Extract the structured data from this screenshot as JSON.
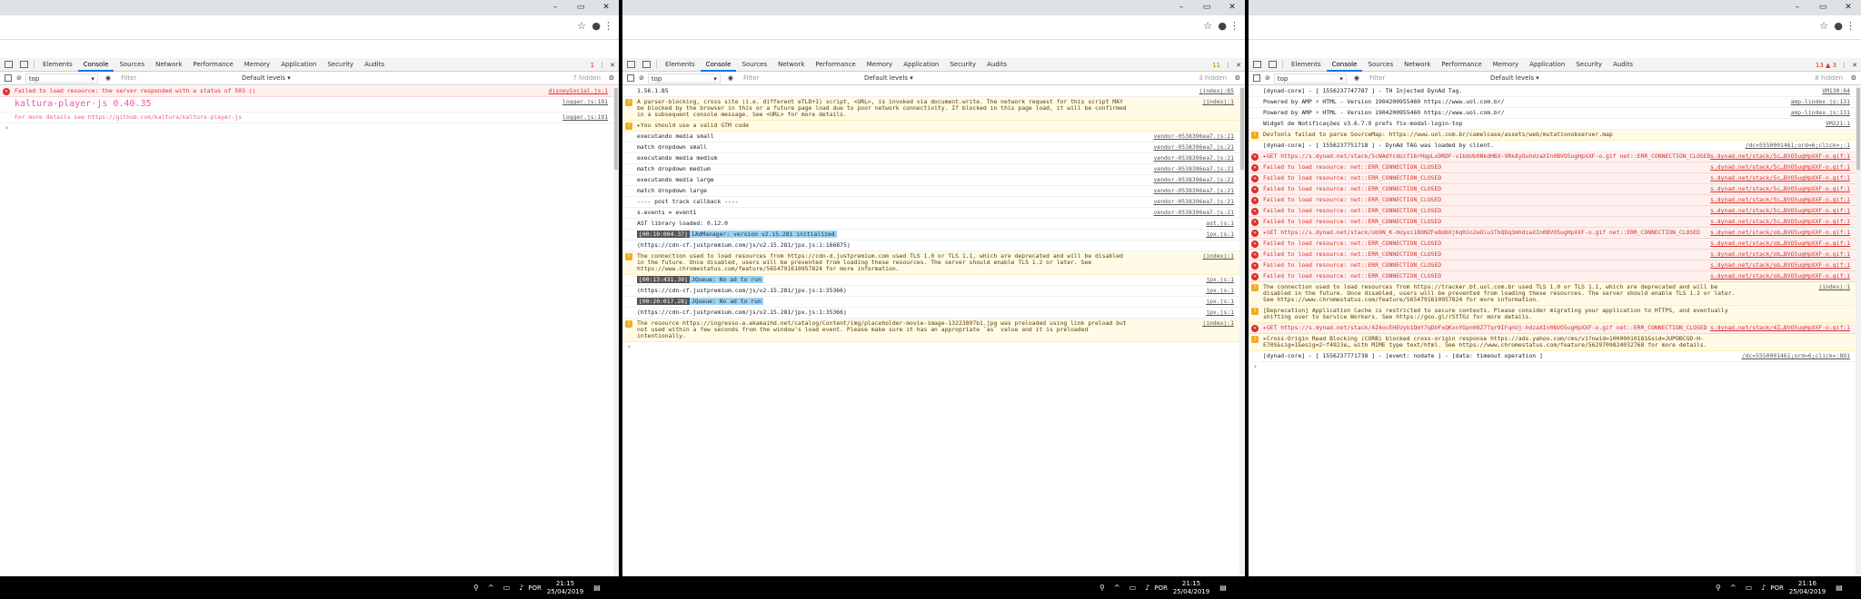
{
  "windows": [
    {
      "devtools": {
        "tabs": [
          "Elements",
          "Console",
          "Sources",
          "Network",
          "Performance",
          "Memory",
          "Application",
          "Security",
          "Audits"
        ],
        "active_tab": "Console",
        "badge": "1",
        "context": "top",
        "filter_placeholder": "Filter",
        "levels": "Default levels ▾",
        "hidden": "7 hidden"
      },
      "rows": [
        {
          "type": "err",
          "text": "Failed to load resource: the server responded with a status of 503 ()",
          "src": "disneySocial.js:1"
        },
        {
          "type": "kal",
          "text": "kaltura-player-js 0.40.35",
          "src": "logger.js:191"
        },
        {
          "type": "kal2",
          "text": "For more details see https://github.com/kaltura/kaltura-player-js",
          "src": "logger.js:191"
        },
        {
          "type": "expand",
          "text": "›",
          "src": ""
        }
      ],
      "taskbar": {
        "lang": "POR",
        "time": "21:15",
        "date": "25/04/2019"
      }
    },
    {
      "devtools": {
        "tabs": [
          "Elements",
          "Console",
          "Sources",
          "Network",
          "Performance",
          "Memory",
          "Application",
          "Security",
          "Audits"
        ],
        "active_tab": "Console",
        "badge": "11",
        "context": "top",
        "filter_placeholder": "Filter",
        "levels": "Default levels ▾",
        "hidden": "3 hidden"
      },
      "rows": [
        {
          "type": "plain",
          "text": "1.56.1.85",
          "src": "(index):65"
        },
        {
          "type": "warn",
          "text": "A parser-blocking, cross site (i.e. different eTLD+1) script, <URL>, is invoked via document.write. The network request for this script MAY be blocked by the browser in this or a future page load due to poor network connectivity. If blocked in this page load, it will be confirmed in a subsequent console message. See <URL> for more details.",
          "src": "(index):1"
        },
        {
          "type": "warn",
          "text": "▸You should use a valid GTM code",
          "src": ""
        },
        {
          "type": "plain",
          "text": "executando media small",
          "src": "vendor-0538396ea7.js:21"
        },
        {
          "type": "plain",
          "text": "match dropdown small",
          "src": "vendor-0538396ea7.js:21"
        },
        {
          "type": "plain",
          "text": "executando media medium",
          "src": "vendor-0538396ea7.js:21"
        },
        {
          "type": "plain",
          "text": "match dropdown medium",
          "src": "vendor-0538396ea7.js:21"
        },
        {
          "type": "plain",
          "text": "executando media large",
          "src": "vendor-0538396ea7.js:21"
        },
        {
          "type": "plain",
          "text": "match dropdown large",
          "src": "vendor-0538396ea7.js:21"
        },
        {
          "type": "plain",
          "text": "---- post track callback ----",
          "src": "vendor-0538396ea7.js:21"
        },
        {
          "type": "plain",
          "text": "s.events = event1",
          "src": "vendor-0538396ea7.js:21"
        },
        {
          "type": "plain",
          "text": "AST library loaded: 0.12.0",
          "src": "ast.js:1"
        },
        {
          "type": "tagged",
          "tag": "[00:10:004.37]",
          "tagb": "IAdManager: version v2.15.281 initialized",
          "text": "",
          "src": "jpx.js:1"
        },
        {
          "type": "plain",
          "text": "(https://cdn-cf.justpremium.com/js/v2.15.281/jpx.js:1:166875)",
          "src": ""
        },
        {
          "type": "warn",
          "text": "The connection used to load resources from https://cdn-d.justpremium.com used TLS 1.0 or TLS 1.1, which are deprecated and will be disabled in the future. Once disabled, users will be prevented from loading these resources. The server should enable TLS 1.2 or later. See https://www.chromestatus.com/feature/5654791610957824 for more information.",
          "src": "(index):1"
        },
        {
          "type": "tagged",
          "tag": "[00:13:431.39]",
          "tagb": "JQueue: No ad to run",
          "text": "",
          "src": "jpx.js:1"
        },
        {
          "type": "plain",
          "text": "(https://cdn-cf.justpremium.com/js/v2.15.281/jpx.js:1:35366)",
          "src": "jpx.js:1"
        },
        {
          "type": "tagged",
          "tag": "[00:20:017.28]",
          "tagb": "JQueue: No ad to run",
          "text": "",
          "src": "jpx.js:1"
        },
        {
          "type": "plain",
          "text": "(https://cdn-cf.justpremium.com/js/v2.15.281/jpx.js:1:35366)",
          "src": "jpx.js:1"
        },
        {
          "type": "warn",
          "text": "The resource https://ingresso-a.akamaihd.net/catalog/Content/img/placeholder-movie-image-13223897b1.jpg was preloaded using link preload but not used within a few seconds from the window's load event. Please make sure it has an appropriate `as` value and it is preloaded intentionally.",
          "src": "(index):1"
        },
        {
          "type": "expand",
          "text": "›",
          "src": ""
        }
      ],
      "taskbar": {
        "lang": "POR",
        "time": "21:15",
        "date": "25/04/2019"
      }
    },
    {
      "devtools": {
        "tabs": [
          "Elements",
          "Console",
          "Sources",
          "Network",
          "Performance",
          "Memory",
          "Application",
          "Security",
          "Audits"
        ],
        "active_tab": "Console",
        "badge": "13 ▲ 3",
        "context": "top",
        "filter_placeholder": "Filter",
        "levels": "Default levels ▾",
        "hidden": "8 hidden"
      },
      "rows": [
        {
          "type": "plain",
          "text": "[dynad-core] - [ 1556237747787 ] - TH Injected DynAd Tag.",
          "src": "VM130:64"
        },
        {
          "type": "plain",
          "text": "Powered by AMP ⚡ HTML - Version 1904200955460 https://www.uol.com.br/",
          "src": "amp-lindex.js:131"
        },
        {
          "type": "plain",
          "text": "Powered by AMP ⚡ HTML - Version 1904200955460 https://www.uol.com.br/",
          "src": "amp-lindex.js:131"
        },
        {
          "type": "plain",
          "text": "Widget de Notificações v3.6.7.9 prefs fix-modal-login-top",
          "src": "VM221:1"
        },
        {
          "type": "warn",
          "text": "DevTools failed to parse SourceMap: https://www.uol.com.br/camelcase/assets/web/mutationobserver.map",
          "src": ""
        },
        {
          "type": "plain",
          "text": "[dynad-core] - [ 1556237751718 ] - DynAd TAG was loaded by client.",
          "src": "/dc=5550001461;ord=6;click=;:1"
        },
        {
          "type": "err",
          "text": "▸GET https://s.dynad.net/stack/5cWAdYcdoif16rHqpLxDRDF-v1bbUb0NkdH6X-9Rk8yOuhdzaXIn0BVO5ugHpXXF-o.gif net::ERR_CONNECTION_CLOSED",
          "src": "s.dynad.net/stack/5c…BVO5ugHpXXF-o.gif:1"
        },
        {
          "type": "err",
          "text": "Failed to load resource: net::ERR_CONNECTION_CLOSED",
          "src": "s.dynad.net/stack/5c…BVO5ugHpXXF-o.gif:1"
        },
        {
          "type": "err",
          "text": "Failed to load resource: net::ERR_CONNECTION_CLOSED",
          "src": "s.dynad.net/stack/5c…BVO5ugHpXXF-o.gif:1"
        },
        {
          "type": "err",
          "text": "Failed to load resource: net::ERR_CONNECTION_CLOSED",
          "src": "s.dynad.net/stack/5c…BVO5ugHpXXF-o.gif:1"
        },
        {
          "type": "err",
          "text": "Failed to load resource: net::ERR_CONNECTION_CLOSED",
          "src": "s.dynad.net/stack/5c…BVO5ugHpXXF-o.gif:1"
        },
        {
          "type": "err",
          "text": "Failed to load resource: net::ERR_CONNECTION_CLOSED",
          "src": "s.dynad.net/stack/5c…BVO5ugHpXXF-o.gif:1"
        },
        {
          "type": "err",
          "text": "Failed to load resource: net::ERR_CONNECTION_CLOSED",
          "src": "s.dynad.net/stack/5c…BVO5ugHpXXF-o.gif:1"
        },
        {
          "type": "err",
          "text": "▸GET https://s.dynad.net/stack/ob9N_K-bUyoi1BONZFeBd6Xj6q0Jo2eOlu1TbQDq3mhdzaXIn0BVO5ugHpXXF-o.gif net::ERR_CONNECTION_CLOSED",
          "src": "s.dynad.net/stack/ob…BVO5ugHpXXF-o.gif:1"
        },
        {
          "type": "err",
          "text": "Failed to load resource: net::ERR_CONNECTION_CLOSED",
          "src": "s.dynad.net/stack/ob…BVO5ugHpXXF-o.gif:1"
        },
        {
          "type": "err",
          "text": "Failed to load resource: net::ERR_CONNECTION_CLOSED",
          "src": "s.dynad.net/stack/ob…BVO5ugHpXXF-o.gif:1"
        },
        {
          "type": "err",
          "text": "Failed to load resource: net::ERR_CONNECTION_CLOSED",
          "src": "s.dynad.net/stack/ob…BVO5ugHpXXF-o.gif:1"
        },
        {
          "type": "err",
          "text": "Failed to load resource: net::ERR_CONNECTION_CLOSED",
          "src": "s.dynad.net/stack/ob…BVO5ugHpXXF-o.gif:1"
        },
        {
          "type": "warn",
          "text": "The connection used to load resources from https://tracker.bt.uol.com.br used TLS 1.0 or TLS 1.1, which are deprecated and will be disabled in the future. Once disabled, users will be prevented from loading these resources. The server should enable TLS 1.2 or later. See https://www.chromestatus.com/feature/5654791610957824 for more information.",
          "src": "(index):1"
        },
        {
          "type": "warn",
          "text": "[Deprecation] Application Cache is restricted to secure contexts. Please consider migrating your application to HTTPS, and eventually shifting over to Service Workers. See https://goo.gl/rStTGz for more details.",
          "src": ""
        },
        {
          "type": "err",
          "text": "▸GET https://s.dynad.net/stack/4Z4ocEHEUyb1DmY7qDOFxQKxnYOpn08Z7Tqr9IFqnUj-hdzaXIn0BVO5ugHpXXF-o.gif net::ERR_CONNECTION_CLOSED",
          "src": "s.dynad.net/stack/4Z…BVO5ugHpXXF-o.gif:1"
        },
        {
          "type": "warn",
          "text": "▸Cross-Origin Read Blocking (CORB) blocked cross-origin response https://ads.yahoo.com/cms/v1?nwid=10000010181&sid=JUPOBCGD-H-E70S&sig=1&esig=2~f4923e… with MIME type text/html. See https://www.chromestatus.com/feature/5629709824032768 for more details.",
          "src": ""
        },
        {
          "type": "plain",
          "text": "[dynad-core] - [ 1556237771738 ] - [event:  nodate ] - [data:  timeout operation ]",
          "src": "/dc=5550001461;ord=6;click=:891"
        },
        {
          "type": "expand",
          "text": "›",
          "src": ""
        }
      ],
      "taskbar": {
        "lang": "POR",
        "time": "21:16",
        "date": "25/04/2019"
      }
    }
  ],
  "colors": {
    "error": "#d93025",
    "warning": "#f2ab26",
    "link": "#1a1aa6",
    "kaltura": "#e85b9b"
  },
  "icons": [
    "minimize-icon",
    "maximize-icon",
    "close-icon",
    "star-icon",
    "profile-icon",
    "menu-icon",
    "inspect-icon",
    "device-icon",
    "clear-icon",
    "eye-icon",
    "gear-icon",
    "network-icon",
    "volume-icon",
    "notification-icon"
  ]
}
